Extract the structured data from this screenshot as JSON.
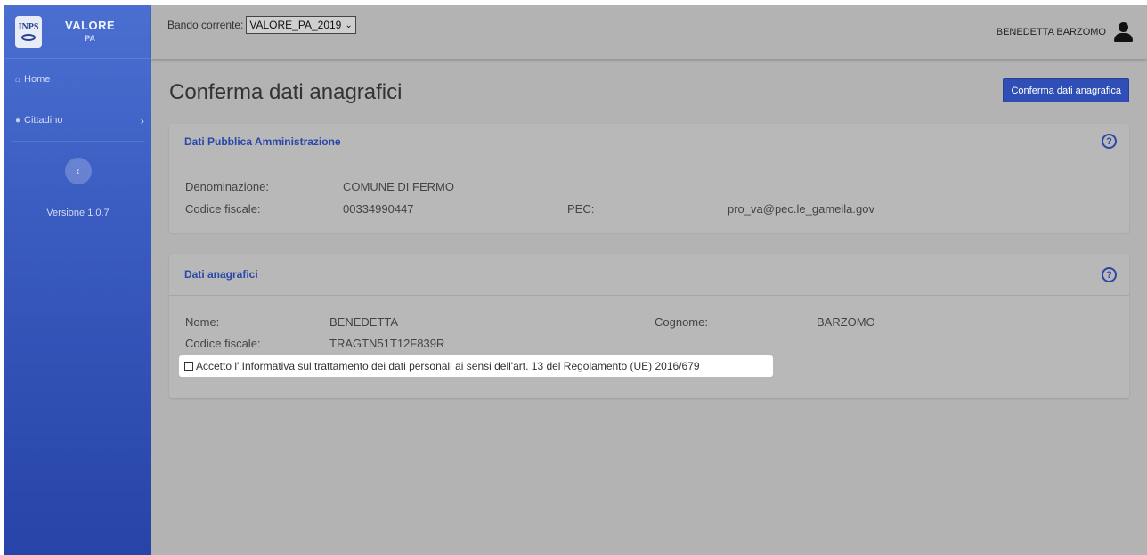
{
  "brand": {
    "logo": "INPS",
    "title": "VALORE",
    "subtitle": "PA"
  },
  "sidebar": {
    "items": [
      {
        "label": "Home",
        "icon": "home-icon"
      },
      {
        "label": "Cittadino",
        "icon": "user-icon"
      }
    ],
    "collapse_glyph": "‹",
    "version": "Versione 1.0.7"
  },
  "topbar": {
    "bando_label": "Bando corrente:",
    "bando_value": "VALORE_PA_2019",
    "user_name": "BENEDETTA BARZOMO"
  },
  "page": {
    "title": "Conferma dati anagrafici",
    "confirm_button": "Conferma dati anagrafica"
  },
  "pa_card": {
    "title": "Dati Pubblica Amministrazione",
    "denominazione_label": "Denominazione:",
    "denominazione_value": "COMUNE DI FERMO",
    "codice_label": "Codice fiscale:",
    "codice_value": "00334990447",
    "pec_label": "PEC:",
    "pec_value": "pro_va@pec.le_gameila.gov"
  },
  "anag_card": {
    "title": "Dati anagrafici",
    "nome_label": "Nome:",
    "nome_value": "BENEDETTA",
    "cognome_label": "Cognome:",
    "cognome_value": "BARZOMO",
    "codice_label": "Codice fiscale:",
    "codice_value": "TRAGTN51T12F839R",
    "privacy_text": "Accetto l' Informativa sul trattamento dei dati personali ai sensi dell'art. 13 del Regolamento (UE) 2016/679",
    "privacy_checked": false
  },
  "help_glyph": "?",
  "colors": {
    "sidebar": "#3a5bc0",
    "accent": "#2a47a8",
    "button": "#2f4fb6",
    "overlay": "#b3b3b3"
  }
}
